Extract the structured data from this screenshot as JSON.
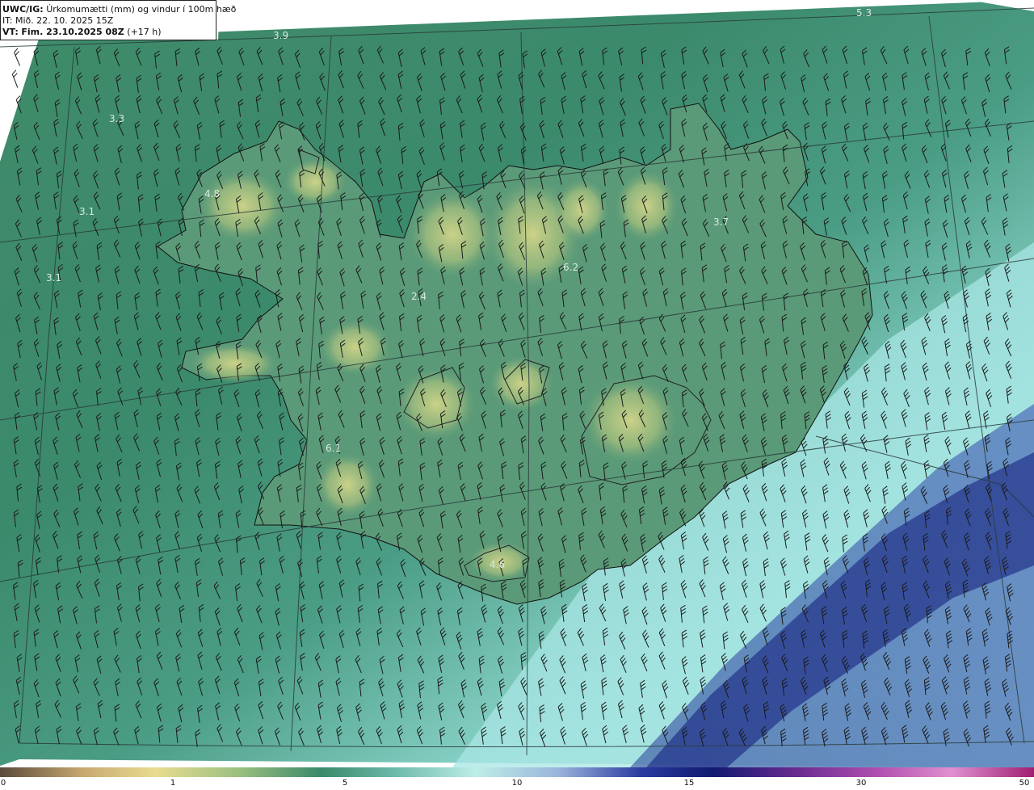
{
  "header": {
    "model": "UWC/IG:",
    "title": "Úrkomumætti (mm) og vindur í 100m hæð",
    "issue_time": "IT: Mið. 22. 10. 2025 15Z",
    "valid_label": "VT:",
    "valid_time": "Fim. 23.10.2025 08Z",
    "lead_time": "(+17 h)"
  },
  "map_labels": [
    {
      "text": "3.9"
    },
    {
      "text": "5.3"
    },
    {
      "text": "3.3"
    },
    {
      "text": "4.8"
    },
    {
      "text": "3.1"
    },
    {
      "text": "3.1"
    },
    {
      "text": "3.7"
    },
    {
      "text": "6.2"
    },
    {
      "text": "2.4"
    },
    {
      "text": "6.1"
    },
    {
      "text": "4.6"
    }
  ],
  "colorbar": {
    "ticks": [
      "0",
      "1",
      "5",
      "10",
      "15",
      "30",
      "50"
    ],
    "colors": [
      "#5a4a3a",
      "#c8a870",
      "#e8dc90",
      "#9cc080",
      "#3a8a6a",
      "#6ab8a8",
      "#bdeee8",
      "#9ab4dc",
      "#2a3aa0",
      "#121a70",
      "#6a2a90",
      "#b050b0",
      "#e090d0",
      "#a02070"
    ]
  }
}
